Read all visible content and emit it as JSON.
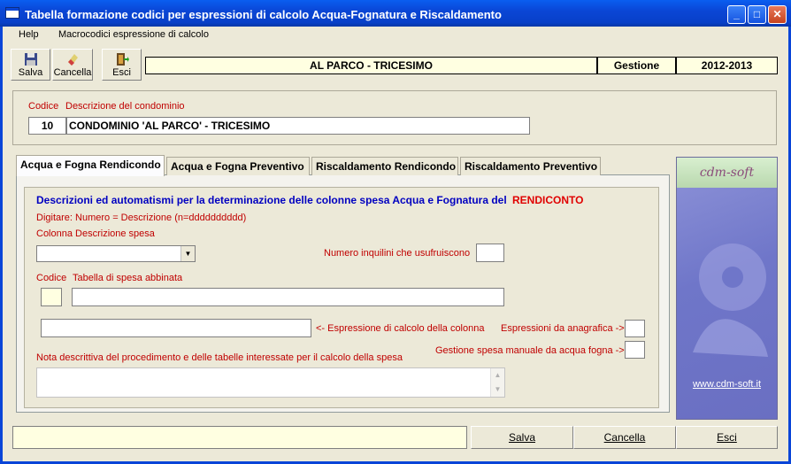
{
  "window": {
    "title": "Tabella formazione codici per espressioni di calcolo Acqua-Fognatura e Riscaldamento",
    "minimize": "_",
    "maximize": "□",
    "close": "✕"
  },
  "menu": {
    "items": [
      "Help",
      "Macrocodici espressione di calcolo"
    ]
  },
  "toolbar": {
    "save": "Salva",
    "cancel": "Cancella",
    "exit": "Esci"
  },
  "info": {
    "condominio": "AL PARCO - TRICESIMO",
    "gestione_label": "Gestione",
    "gestione_value": "2012-2013"
  },
  "header": {
    "codice_label": "Codice",
    "descrizione_label": "Descrizione del condominio",
    "codice_value": "10",
    "descrizione_value": "CONDOMINIO 'AL PARCO' - TRICESIMO"
  },
  "tabs": [
    {
      "label": "Acqua e Fogna Rendicondo",
      "active": true
    },
    {
      "label": "Acqua e Fogna Preventivo",
      "active": false
    },
    {
      "label": "Riscaldamento Rendicondo",
      "active": false
    },
    {
      "label": "Riscaldamento Preventivo",
      "active": false
    }
  ],
  "panel": {
    "heading": "Descrizioni ed automatismi per la determinazione delle colonne spesa Acqua e Fognatura del",
    "heading_highlight": "RENDICONTO",
    "hint": "Digitare:   Numero = Descrizione (n=dddddddddd)",
    "colonna_label": "Colonna  Descrizione spesa",
    "colonna_value": "",
    "inquilini_label": "Numero inquilini che usufruiscono",
    "inquilini_value": "",
    "codice_label": "Codice",
    "tabella_label": "Tabella di spesa abbinata",
    "codice_value": "",
    "tabella_value": "",
    "espressione_value": "",
    "espressione_label": "<- Espressione di calcolo della colonna",
    "anagrafica_label": "Espressioni da anagrafica ->",
    "manuale_label": "Gestione spesa manuale da acqua fogna ->",
    "nota_label": "Nota descrittiva del procedimento e delle tabelle interessate per il calcolo della spesa",
    "nota_value": ""
  },
  "side": {
    "logo": "cdm-soft",
    "link": "www.cdm-soft.it"
  },
  "footer": {
    "status": "",
    "save": "Salva",
    "cancel": "Cancella",
    "exit": "Esci"
  },
  "colors": {
    "title_blue": "#0A46D6",
    "label_red": "#C00000",
    "heading_blue": "#0000C0",
    "tooltip_yellow": "#FFFFE1"
  }
}
